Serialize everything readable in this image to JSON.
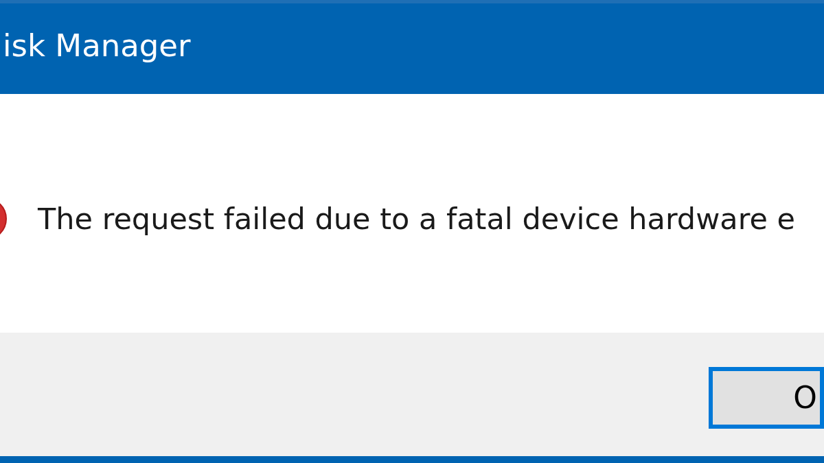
{
  "window": {
    "title": "isk Manager"
  },
  "message": {
    "kind": "error",
    "text": "The request failed due to a fatal device hardware e"
  },
  "buttons": [
    {
      "label": "O",
      "default": true
    }
  ]
}
